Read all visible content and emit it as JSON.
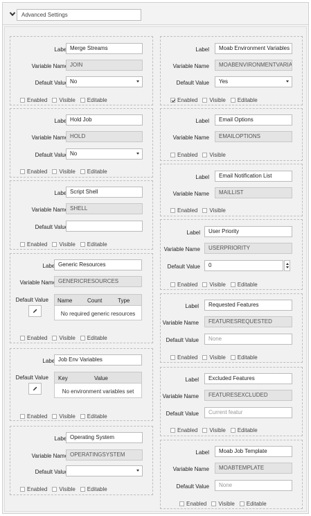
{
  "header": {
    "title": "Advanced Settings"
  },
  "labels": {
    "label": "Label",
    "variable_name": "Variable Name",
    "default_value": "Default Value"
  },
  "checks": {
    "enabled": "Enabled",
    "visible": "Visible",
    "editable": "Editable"
  },
  "cards": {
    "merge": {
      "label": "Merge Streams",
      "var": "JOIN",
      "value": "No",
      "enabled": false
    },
    "hold": {
      "label": "Hold Job",
      "var": "HOLD",
      "value": "No"
    },
    "shell": {
      "label": "Script Shell",
      "var": "SHELL",
      "value": ""
    },
    "gres": {
      "label": "Generic Resources",
      "var": "GENERICRESOURCES",
      "cols": [
        "Name",
        "Count",
        "Type"
      ],
      "empty": "No required generic resources"
    },
    "envvars": {
      "label": "Job Env Variables",
      "cols": [
        "Key",
        "Value"
      ],
      "empty": "No environment variables set"
    },
    "os": {
      "label": "Operating System",
      "var": "OPERATINGSYSTEM",
      "value": ""
    },
    "moabenv": {
      "label": "Moab Environment Variables",
      "var": "MOABENVIRONMENTVARIAB",
      "value": "Yes",
      "enabled": true
    },
    "email": {
      "label": "Email Options",
      "var": "EMAILOPTIONS"
    },
    "maillist": {
      "label": "Email Notification List",
      "var": "MAILLIST"
    },
    "priority": {
      "label": "User Priority",
      "var": "USERPRIORITY",
      "value": "0"
    },
    "features": {
      "label": "Requested Features",
      "var": "FEATURESREQUESTED",
      "placeholder": "None"
    },
    "excluded": {
      "label": "Excluded Features",
      "var": "FEATURESEXCLUDED",
      "placeholder": "Current featur"
    },
    "template": {
      "label": "Moab Job Template",
      "var": "MOABTEMPLATE",
      "placeholder": "None"
    }
  },
  "icons": {
    "collapse": "chevron-down-icon",
    "edit": "pencil-icon"
  }
}
